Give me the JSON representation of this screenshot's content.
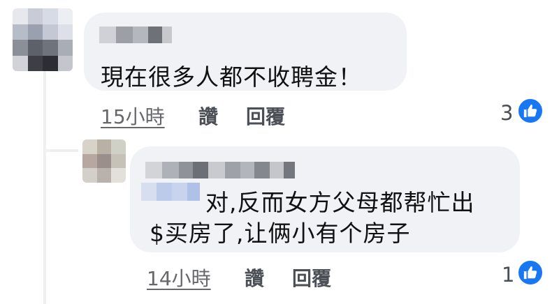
{
  "comments": [
    {
      "author": "",
      "text": "現在很多人都不收聘金！",
      "time": "15小時",
      "like_label": "讚",
      "reply_label": "回覆",
      "reaction_count": "3"
    },
    {
      "author": "",
      "mention": "",
      "text_line1": "对,反而女方父母都帮忙出",
      "text_line2": "$买房了,让俩小有个房子",
      "time": "14小時",
      "like_label": "讚",
      "reply_label": "回覆",
      "reaction_count": "1"
    }
  ],
  "colors": {
    "bubble": "#f0f2f5",
    "like_blue": "#1877f2",
    "meta_text": "#65676b"
  },
  "icons": {
    "reaction": "thumbs-up-icon"
  }
}
